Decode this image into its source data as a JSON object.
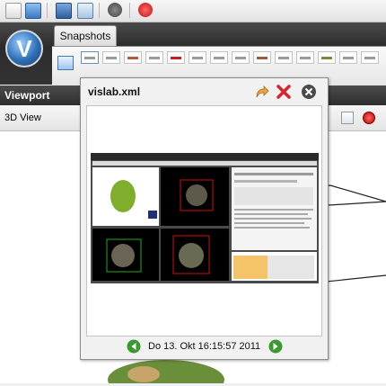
{
  "ribbon": {
    "tab_label": "Snapshots",
    "logo_letter": "V"
  },
  "viewport": {
    "header": "Viewport",
    "view_label": "3D View"
  },
  "popup": {
    "title": "vislab.xml",
    "timestamp": "Do 13. Okt 16:15:57 2011",
    "icons": {
      "export": "share-arrow-icon",
      "delete": "red-x-icon",
      "close": "close-circle-icon",
      "prev": "green-left-arrow-icon",
      "next": "green-right-arrow-icon"
    }
  },
  "colors": {
    "ribbon_dark": "#333333",
    "accent_blue": "#2d6fb8",
    "nav_green": "#3b9a2f",
    "delete_red": "#d9232d",
    "export_orange": "#e9a43c"
  }
}
